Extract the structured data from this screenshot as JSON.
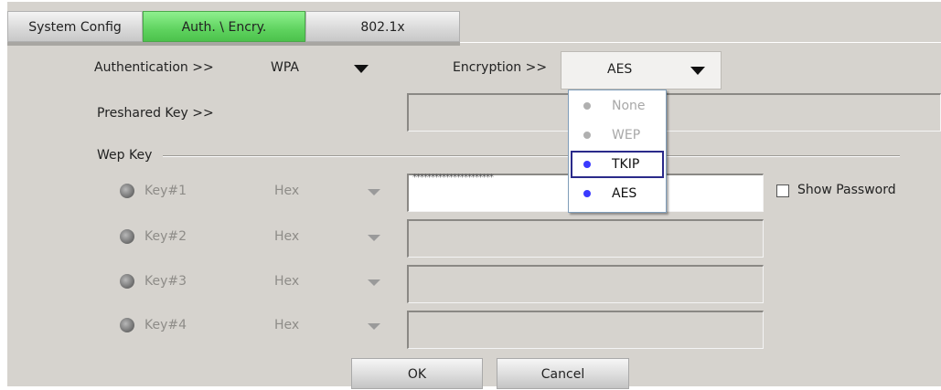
{
  "tabs": [
    {
      "label": "System Config"
    },
    {
      "label": "Auth. \\ Encry."
    },
    {
      "label": "802.1x"
    }
  ],
  "authentication": {
    "label": "Authentication >>",
    "value": "WPA"
  },
  "encryption": {
    "label": "Encryption >>",
    "value": "AES",
    "options": [
      {
        "label": "None",
        "enabled": false
      },
      {
        "label": "WEP",
        "enabled": false
      },
      {
        "label": "TKIP",
        "enabled": true,
        "highlighted": true
      },
      {
        "label": "AES",
        "enabled": true
      }
    ]
  },
  "preshared_key": {
    "label": "Preshared Key >>",
    "value": ""
  },
  "wep": {
    "group_label": "Wep Key",
    "keys": [
      {
        "label": "Key#1",
        "format": "Hex",
        "value": "**********************"
      },
      {
        "label": "Key#2",
        "format": "Hex",
        "value": ""
      },
      {
        "label": "Key#3",
        "format": "Hex",
        "value": ""
      },
      {
        "label": "Key#4",
        "format": "Hex",
        "value": ""
      }
    ]
  },
  "show_password": {
    "label": "Show Password",
    "checked": false
  },
  "buttons": {
    "ok": "OK",
    "cancel": "Cancel"
  }
}
